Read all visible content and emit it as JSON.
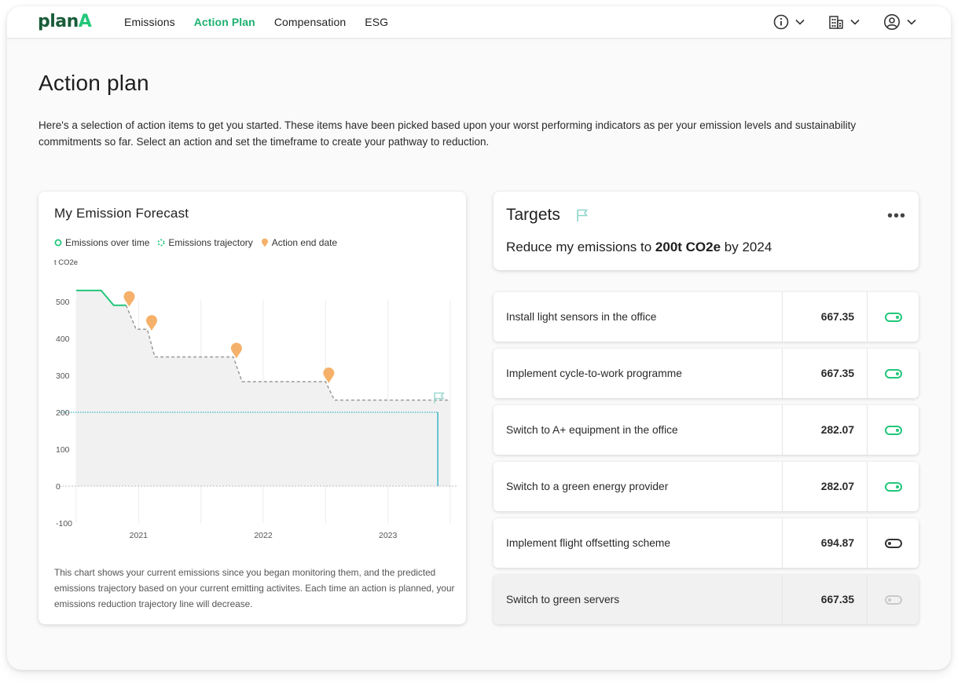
{
  "brand": {
    "name_left": "plan",
    "name_right": "A",
    "primary": "#1a5c3a",
    "accent": "#22c77a"
  },
  "nav": {
    "items": [
      {
        "label": "Emissions",
        "active": false
      },
      {
        "label": "Action Plan",
        "active": true
      },
      {
        "label": "Compensation",
        "active": false
      },
      {
        "label": "ESG",
        "active": false
      }
    ]
  },
  "tools": {
    "info_icon": "info-icon",
    "building_icon": "building-icon",
    "user_icon": "user-icon"
  },
  "page": {
    "title": "Action plan",
    "intro": "Here's a selection of action items to get you started. These items have been picked based upon your worst performing indicators as per your emission levels and sustainability commitments so far.  Select an action and set the timeframe to create your pathway to reduction."
  },
  "forecast": {
    "title": "My Emission Forecast",
    "legend": {
      "emissions_over_time": "Emissions over time",
      "emissions_trajectory": "Emissions trajectory",
      "action_end_date": "Action end date"
    },
    "unit": "t CO2e",
    "note": "This chart shows your current emissions since you began monitoring them, and the predicted emissions trajectory based on your current emitting activites. Each time an action is planned, your emissions reduction trajectory line will decrease."
  },
  "chart_data": {
    "type": "line",
    "ylabel": "t CO2e",
    "ylim": [
      -100,
      500
    ],
    "y_ticks": [
      500,
      400,
      300,
      200,
      100,
      0,
      -100
    ],
    "x_ticks": [
      "2021",
      "2022",
      "2023"
    ],
    "series": [
      {
        "name": "Emissions over time",
        "color": "#22c77a",
        "points": [
          [
            2020.5,
            530
          ],
          [
            2020.7,
            530
          ],
          [
            2020.8,
            490
          ],
          [
            2020.9,
            490
          ]
        ]
      },
      {
        "name": "Emissions trajectory",
        "color": "#9a9a9a",
        "points": [
          [
            2020.9,
            490
          ],
          [
            2020.98,
            425
          ],
          [
            2021.07,
            425
          ],
          [
            2021.13,
            350
          ],
          [
            2021.76,
            350
          ],
          [
            2021.83,
            283
          ],
          [
            2022.5,
            283
          ],
          [
            2022.57,
            233
          ],
          [
            2023.5,
            233
          ]
        ]
      }
    ],
    "target_line": {
      "value": 200,
      "color": "#3bb6c9"
    },
    "action_end_dates": [
      2020.9,
      2021.08,
      2021.76,
      2022.5
    ],
    "target_flag": {
      "x": 2023.4,
      "y": 233
    }
  },
  "targets": {
    "title": "Targets",
    "more_label": "•••",
    "text_prefix": "Reduce my emissions to ",
    "text_value": "200t CO2e",
    "text_suffix": " by 2024"
  },
  "actions": [
    {
      "name": "Install light sensors in the office",
      "value": "667.35",
      "state": "on"
    },
    {
      "name": "Implement cycle-to-work programme",
      "value": "667.35",
      "state": "on"
    },
    {
      "name": "Switch to A+ equipment in the office",
      "value": "282.07",
      "state": "on"
    },
    {
      "name": "Switch to a green energy provider",
      "value": "282.07",
      "state": "on"
    },
    {
      "name": "Implement flight offsetting scheme",
      "value": "694.87",
      "state": "off"
    },
    {
      "name": "Switch to green servers",
      "value": "667.35",
      "state": "disabled"
    }
  ]
}
